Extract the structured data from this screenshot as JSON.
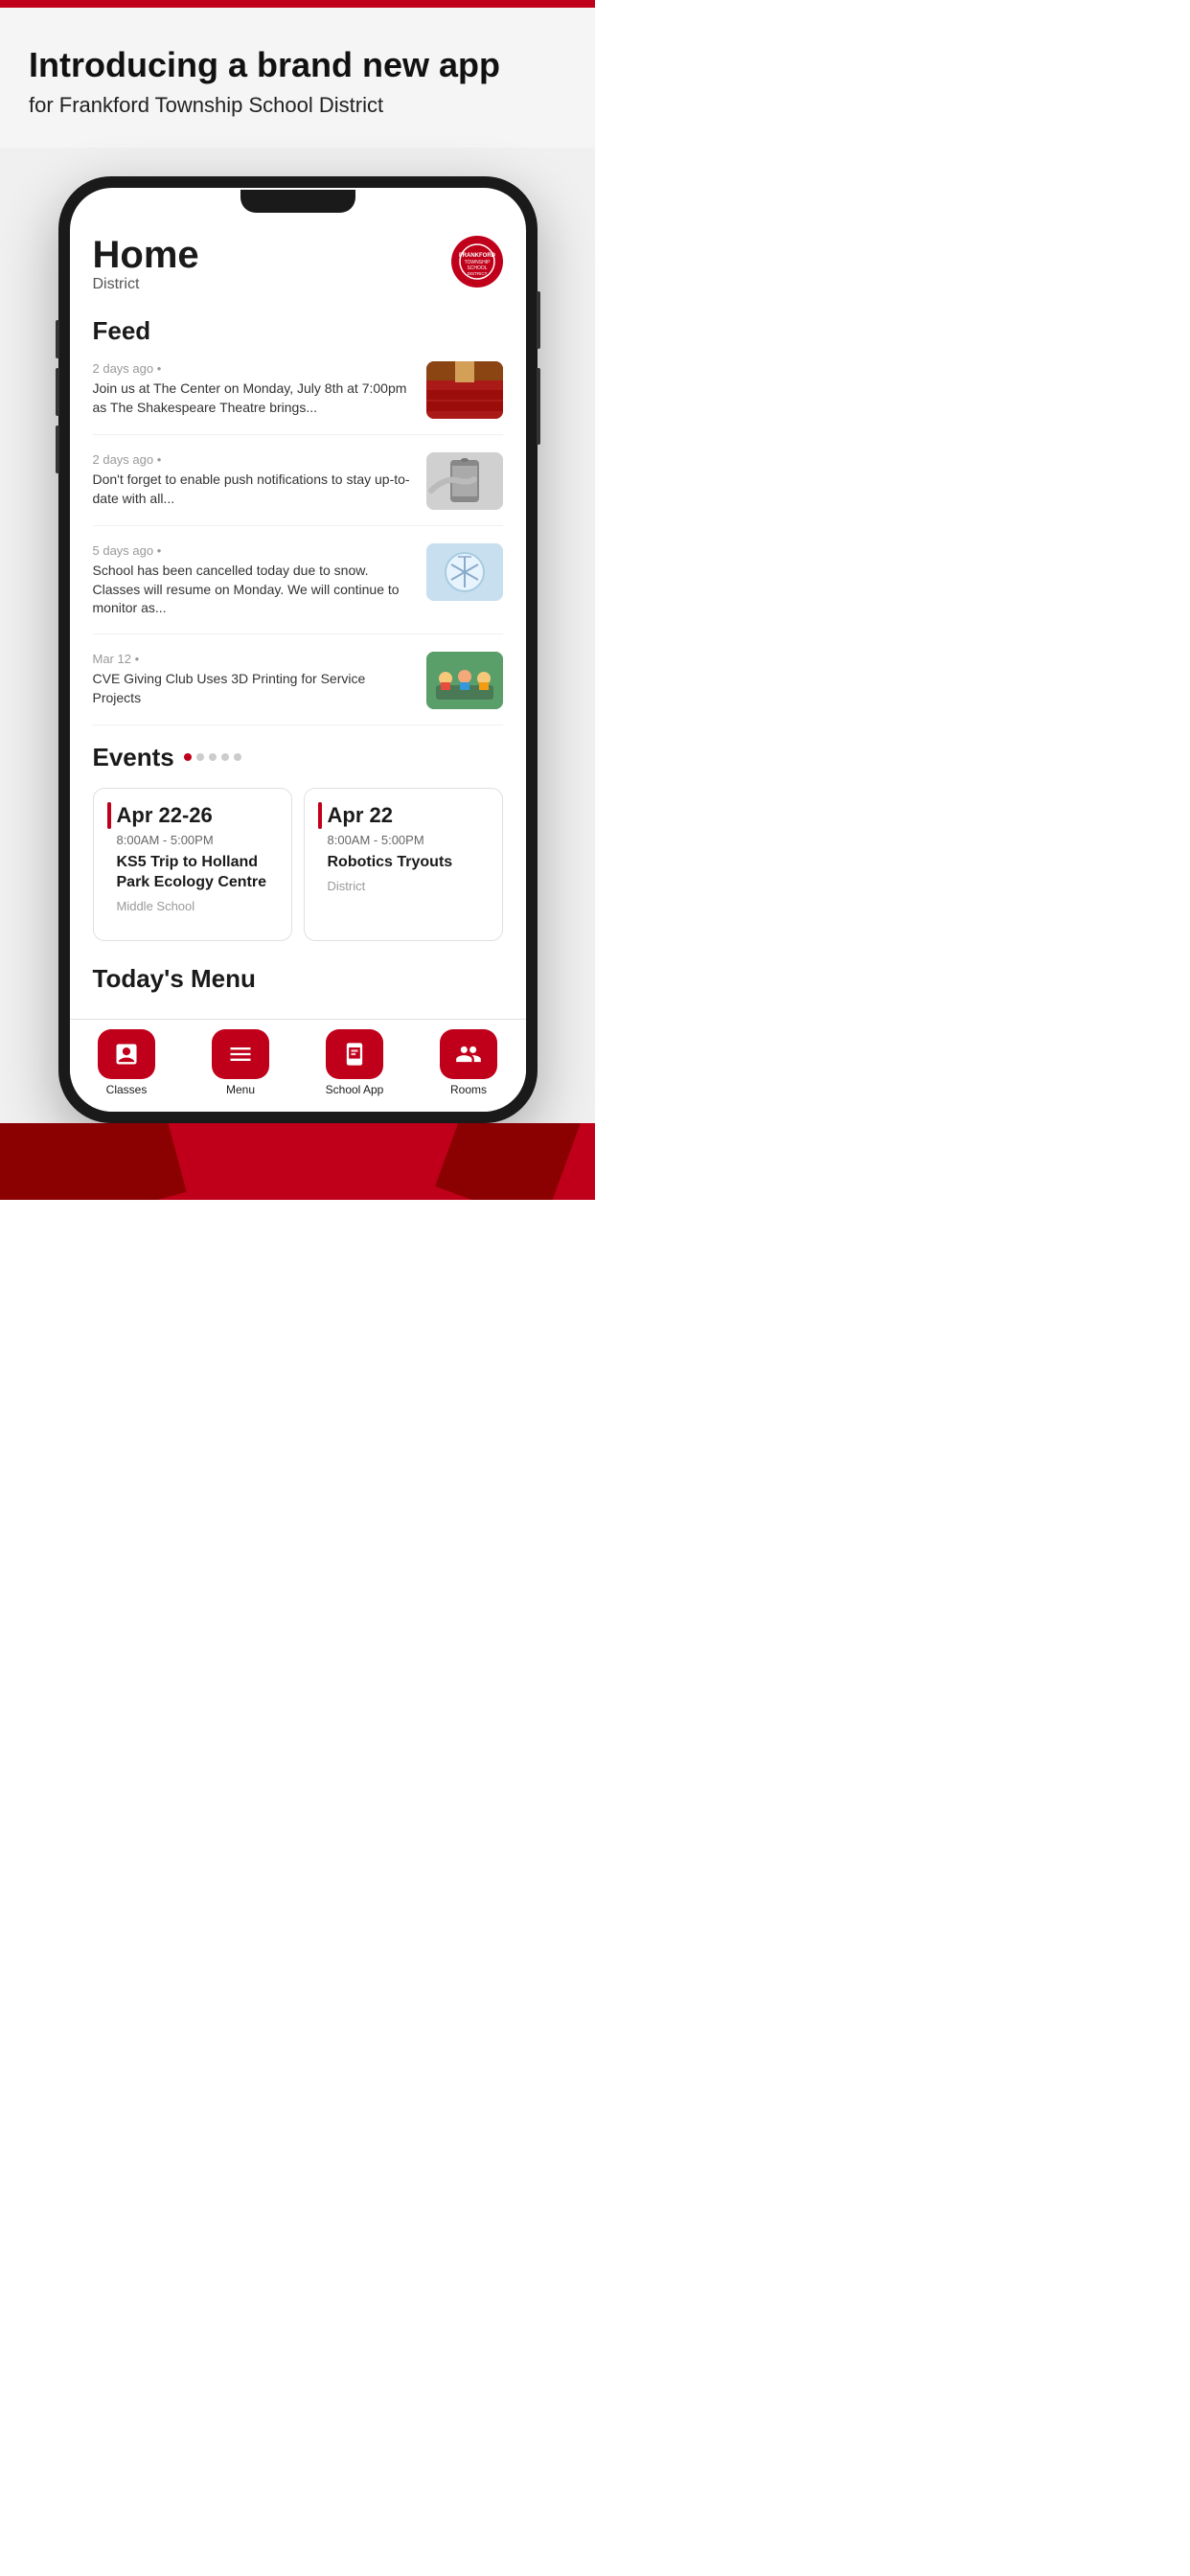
{
  "topBar": {},
  "header": {
    "title": "Introducing a brand new app",
    "subtitle": "for Frankford Township School District"
  },
  "phone": {
    "screen": {
      "homeTitle": "Home",
      "homeSubtitle": "District",
      "feedTitle": "Feed",
      "feedItems": [
        {
          "time": "2 days ago",
          "text": "Join us at The Center on Monday, July 8th at 7:00pm as The Shakespeare Theatre brings...",
          "imgType": "theater"
        },
        {
          "time": "2 days ago",
          "text": "Don't forget to enable push notifications to stay up-to-date with all...",
          "imgType": "phone"
        },
        {
          "time": "5 days ago",
          "text": "School has been cancelled today due to snow. Classes will resume on Monday. We will continue to monitor as...",
          "imgType": "snow"
        },
        {
          "time": "Mar 12",
          "text": "CVE Giving Club Uses 3D Printing for Service Projects",
          "imgType": "class"
        }
      ],
      "eventsTitle": "Events",
      "events": [
        {
          "date": "Apr 22-26",
          "time": "8:00AM  -  5:00PM",
          "name": "KS5 Trip to Holland Park Ecology Centre",
          "location": "Middle School"
        },
        {
          "date": "Apr 22",
          "time": "8:00AM  -  5:00PM",
          "name": "Robotics Tryouts",
          "location": "District"
        }
      ],
      "menuTitle": "Today's Menu",
      "navItems": [
        {
          "label": "Classes",
          "icon": "classes"
        },
        {
          "label": "Menu",
          "icon": "menu"
        },
        {
          "label": "School App",
          "icon": "school-app"
        },
        {
          "label": "Rooms",
          "icon": "rooms"
        }
      ]
    }
  }
}
